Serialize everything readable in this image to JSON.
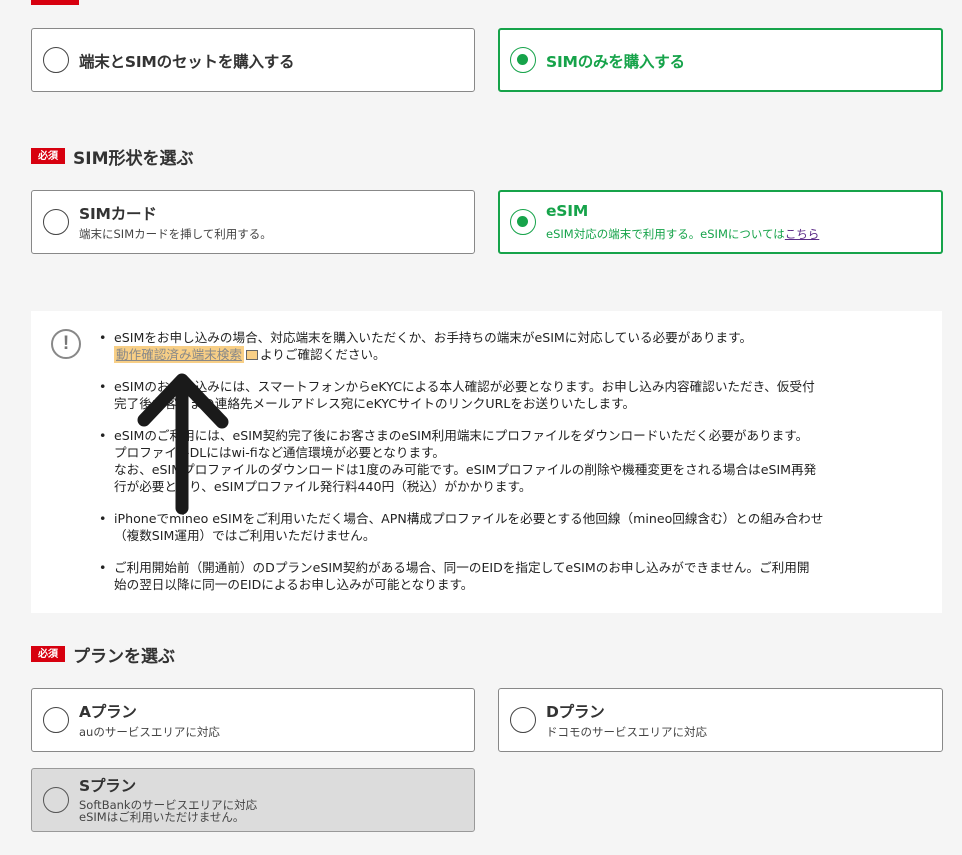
{
  "purchase_type": {
    "options": [
      {
        "label": "端末とSIMのセットを購入する"
      },
      {
        "label": "SIMのみを購入する"
      }
    ]
  },
  "sim_shape": {
    "badge": "必須",
    "title": "SIM形状を選ぶ",
    "options": [
      {
        "label": "SIMカード",
        "desc": "端末にSIMカードを挿して利用する。"
      },
      {
        "label": "eSIM",
        "desc": "eSIM対応の端末で利用する。eSIMについては",
        "link": "こちら"
      }
    ]
  },
  "notice": {
    "icon": "exclamation-circle-icon",
    "items": [
      {
        "lines": [
          "eSIMをお申し込みの場合、対応端末を購入いただくか、お手持ちの端末がeSIMに対応している必要があります。"
        ],
        "link": "動作確認済み端末検索",
        "after_link": "よりご確認ください。"
      },
      {
        "lines": [
          "eSIMのお申し込みには、スマートフォンからeKYCによる本人確認が必要となります。お申し込み内容確認いただき、仮受付",
          "完了後お客さまの連絡先メールアドレス宛にeKYCサイトのリンクURLをお送りいたします。"
        ]
      },
      {
        "lines": [
          "eSIMのご利用には、eSIM契約完了後にお客さまのeSIM利用端末にプロファイルをダウンロードいただく必要があります。",
          "プロファイルDLにはwi-fiなど通信環境が必要となります。",
          "なお、eSIMプロファイルのダウンロードは1度のみ可能です。eSIMプロファイルの削除や機種変更をされる場合はeSIM再発",
          "行が必要となり、eSIMプロファイル発行料440円（税込）がかかります。"
        ]
      },
      {
        "lines": [
          "iPhoneでmineo eSIMをご利用いただく場合、APN構成プロファイルを必要とする他回線（mineo回線含む）との組み合わせ",
          "（複数SIM運用）ではご利用いただけません。"
        ]
      },
      {
        "lines": [
          "ご利用開始前（開通前）のDプランeSIM契約がある場合、同一のEIDを指定してeSIMのお申し込みができません。ご利用開",
          "始の翌日以降に同一のEIDによるお申し込みが可能となります。"
        ]
      }
    ]
  },
  "plan": {
    "badge": "必須",
    "title": "プランを選ぶ",
    "options": [
      {
        "label": "Aプラン",
        "desc": "auのサービスエリアに対応"
      },
      {
        "label": "Dプラン",
        "desc": "ドコモのサービスエリアに対応"
      },
      {
        "label": "Sプラン",
        "desc": "SoftBankのサービスエリアに対応",
        "desc2": "eSIMはご利用いただけません。"
      }
    ]
  },
  "colors": {
    "brand_red": "#d7000f",
    "selected_green": "#16a34a",
    "highlight": "#f8cf86"
  },
  "annotation": "up-arrow-annotation"
}
